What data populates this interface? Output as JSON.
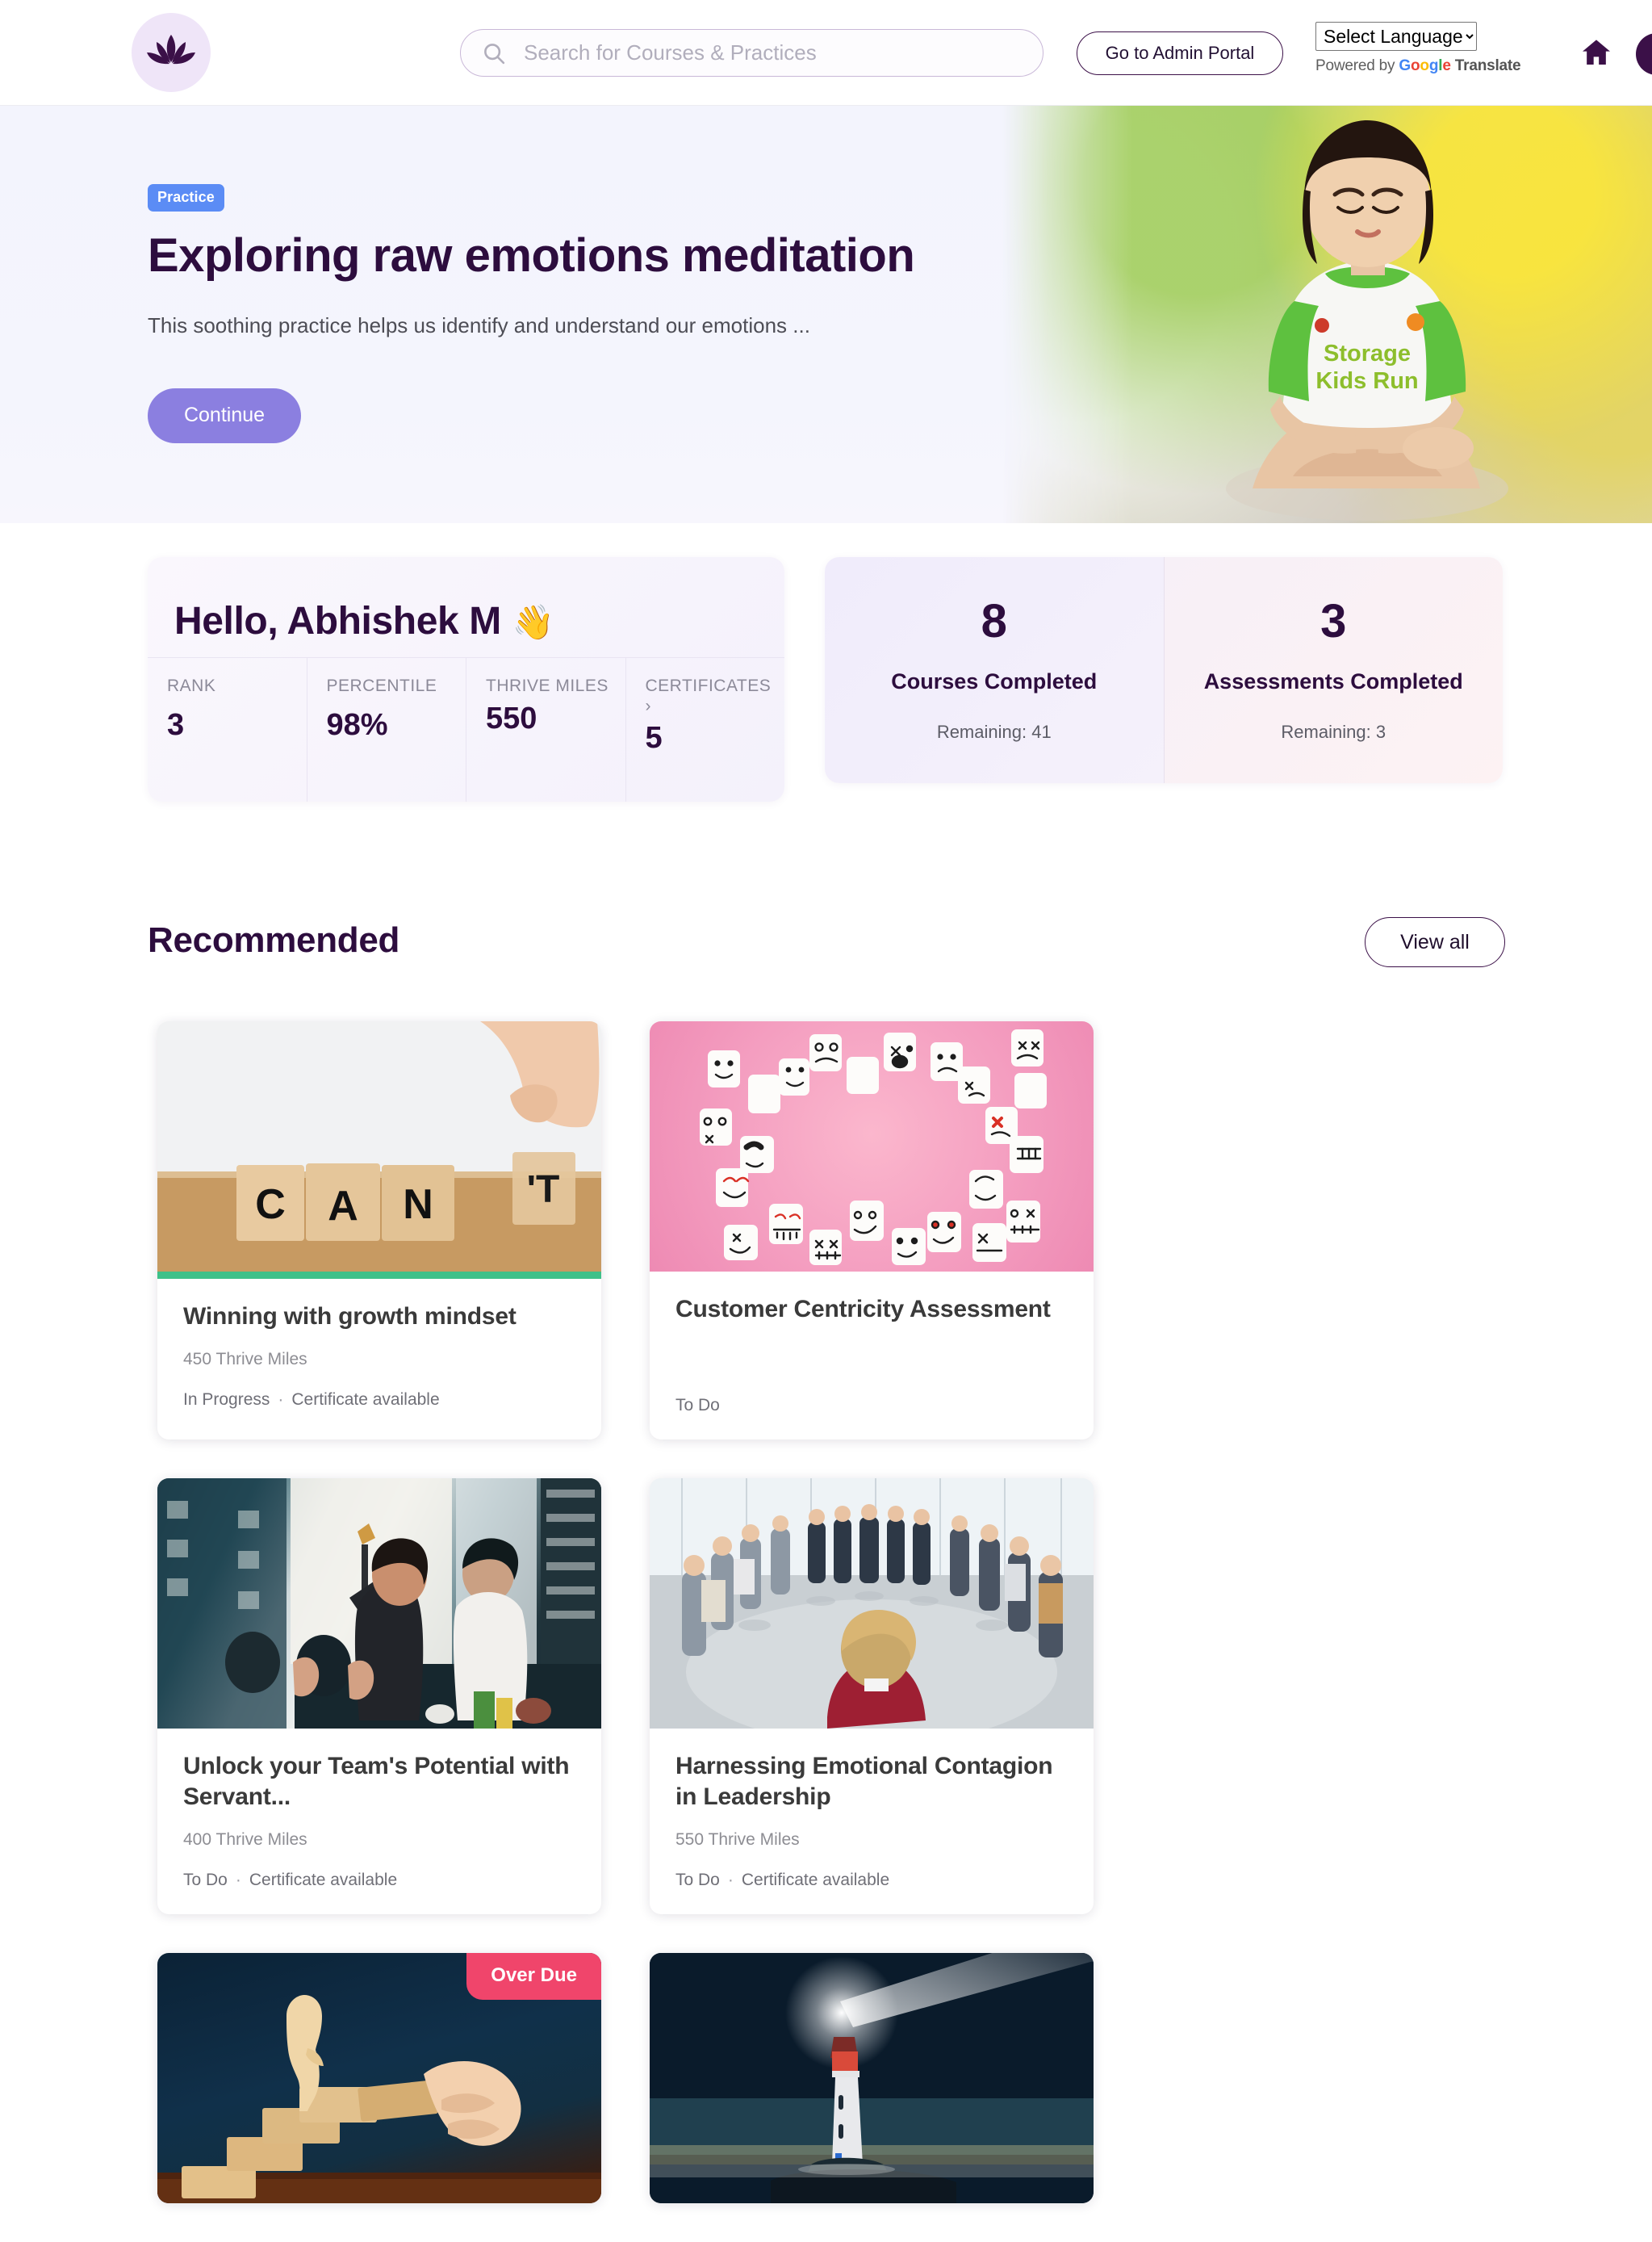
{
  "header": {
    "logo_icon": "lotus-logo-icon",
    "search": {
      "placeholder": "Search for Courses & Practices",
      "value": "",
      "icon": "search-icon"
    },
    "admin_button": "Go to Admin Portal",
    "language": {
      "selected": "Select Language",
      "options": [
        "Select Language"
      ]
    },
    "translate_credit_prefix": "Powered by ",
    "translate_google": "Google",
    "translate_suffix": " Translate",
    "home_icon": "home-icon",
    "avatar": "user-avatar"
  },
  "hero": {
    "tag": "Practice",
    "title": "Exploring raw emotions meditation",
    "description": "This soothing practice helps us identify and understand our emotions ...",
    "cta": "Continue",
    "carousel": {
      "count": 3,
      "active_index": 1
    }
  },
  "greeting": {
    "title": "Hello, Abhishek M",
    "wave": "👋",
    "stats": [
      {
        "label": "RANK",
        "value": "3",
        "chevron": ""
      },
      {
        "label": "PERCENTILE",
        "value": "98%",
        "chevron": ""
      },
      {
        "label": "THRIVE MILES",
        "value": "550",
        "chevron": ""
      },
      {
        "label": "CERTIFICATES",
        "value": "5",
        "chevron": "›"
      }
    ]
  },
  "counts": [
    {
      "number": "8",
      "label": "Courses Completed",
      "remaining": "Remaining: 41"
    },
    {
      "number": "3",
      "label": "Assessments Completed",
      "remaining": "Remaining: 3"
    }
  ],
  "recommended": {
    "title": "Recommended",
    "view_all": "View all",
    "cards": [
      {
        "title": "Winning with growth mindset",
        "miles": "450 Thrive Miles",
        "status": "In Progress",
        "certificate": "Certificate available",
        "separator": "·",
        "progress": true,
        "badge": "",
        "image": "wooden-blocks-cant-image"
      },
      {
        "title": "Customer Centricity Assessment",
        "miles": "",
        "status": "To Do",
        "certificate": "",
        "separator": "",
        "progress": false,
        "badge": "",
        "image": "marshmallow-faces-pink-image"
      },
      {
        "title": "Unlock your Team's Potential with Servant...",
        "miles": "400 Thrive Miles",
        "status": "To Do",
        "certificate": "Certificate available",
        "separator": "·",
        "progress": false,
        "badge": "",
        "image": "team-celebration-image"
      },
      {
        "title": "Harnessing Emotional Contagion in Leadership",
        "miles": "550 Thrive Miles",
        "status": "To Do",
        "certificate": "Certificate available",
        "separator": "·",
        "progress": false,
        "badge": "",
        "image": "people-circle-office-image"
      },
      {
        "title": "",
        "miles": "",
        "status": "",
        "certificate": "",
        "separator": "",
        "progress": false,
        "badge": "Over Due",
        "image": "wooden-stairs-figure-image"
      },
      {
        "title": "",
        "miles": "",
        "status": "",
        "certificate": "",
        "separator": "",
        "progress": false,
        "badge": "",
        "image": "lighthouse-night-image"
      }
    ]
  },
  "colors": {
    "brand_purple": "#2d0d3e",
    "accent_purple": "#8b7fe0",
    "practice_blue": "#5b8cf5",
    "progress_green": "#3ec189",
    "overdue_pink": "#f0456b"
  }
}
